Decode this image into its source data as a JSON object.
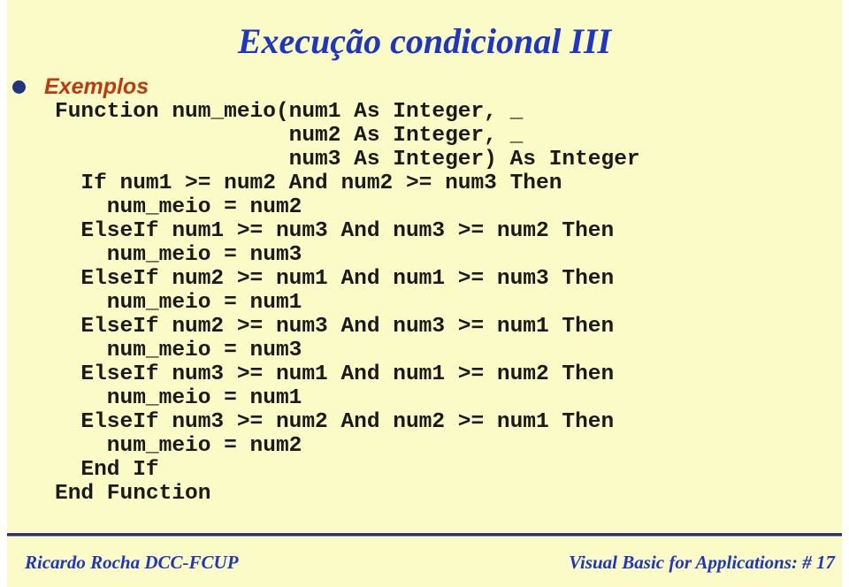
{
  "slide": {
    "background_color": "#fbfbc8",
    "page_margin_color": "#ffffff",
    "title": "Execução condicional III",
    "title_color": "#1f35c4",
    "bullet": {
      "icon": "bullet-dot-icon",
      "color": "#23357d",
      "label": "Exemplos",
      "label_color": "#c03a10"
    },
    "code": {
      "language": "Visual Basic for Applications",
      "color": "#1a1a1a",
      "lines": [
        "Function num_meio(num1 As Integer, _",
        "                  num2 As Integer, _",
        "                  num3 As Integer) As Integer",
        "  If num1 >= num2 And num2 >= num3 Then",
        "    num_meio = num2",
        "  ElseIf num1 >= num3 And num3 >= num2 Then",
        "    num_meio = num3",
        "  ElseIf num2 >= num1 And num1 >= num3 Then",
        "    num_meio = num1",
        "  ElseIf num2 >= num3 And num3 >= num1 Then",
        "    num_meio = num3",
        "  ElseIf num3 >= num1 And num1 >= num2 Then",
        "    num_meio = num1",
        "  ElseIf num3 >= num2 And num2 >= num1 Then",
        "    num_meio = num2",
        "  End If",
        "End Function"
      ]
    },
    "footer": {
      "rule_color": "#2b3170",
      "left": "Ricardo Rocha DCC-FCUP",
      "right": "Visual Basic for Applications: # 17",
      "text_color": "#1f35c4"
    }
  }
}
